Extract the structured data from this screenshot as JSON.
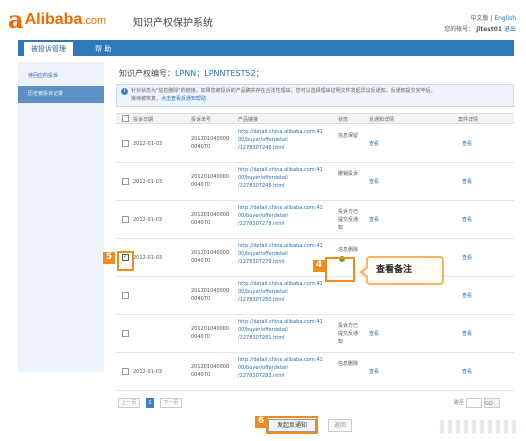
{
  "header": {
    "logo_mark": "a",
    "logo_text": "Alibaba",
    "logo_domain": ".com",
    "system_title": "知识产权保护系统",
    "lang_current": "中文版",
    "lang_separator": "|",
    "lang_english": "English",
    "account_prefix": "您的帐号：",
    "account_name": "jltest01",
    "logout": "退出"
  },
  "nav": {
    "tabs": [
      {
        "label": "被投诉管理"
      },
      {
        "label": "帮 助"
      }
    ]
  },
  "sidebar": {
    "items": [
      {
        "label": "待回应的投诉"
      },
      {
        "label": "历史被投诉记录"
      }
    ]
  },
  "main": {
    "ip_title_prefix": "知识产权编号：",
    "ip_numbers": "LPNN；LPNNTEST52；",
    "notice_icon": "i",
    "notice_text": "针对状态为\"信息删除\"的链接，如果您被投诉的产品确实存在合法性理由，您可以选择理由证明文件发起异议反通知。反通知提交完毕后，",
    "notice_text2": "接待被恢复。",
    "notice_link": "点击查看反通知帮助",
    "columns": [
      "投诉日期",
      "投诉单号",
      "产品链接",
      "状态",
      "反通知详情",
      "案件详情"
    ],
    "rows": [
      {
        "date": "2012-01-03",
        "id1": "201201040000",
        "id2": "004070",
        "url1": "http://detail.china.alibaba.com:41",
        "url2": "00/buyer/offerdetail",
        "url3": "/1278307246.html",
        "status1": "信息保留",
        "status2": "",
        "status3": "",
        "notice": "查看",
        "detail": "查看",
        "checked": false
      },
      {
        "date": "2012-01-03",
        "id1": "201201040000",
        "id2": "004070",
        "url1": "http://detail.china.alibaba.com:41",
        "url2": "00/buyer/offerdetail",
        "url3": "/1278307246.html",
        "status1": "撤销投诉",
        "status2": "",
        "status3": "",
        "notice": "查看",
        "detail": "查看",
        "checked": false
      },
      {
        "date": "2012-01-03",
        "id1": "201201040000",
        "id2": "004070",
        "url1": "http://detail.china.alibaba.com:41",
        "url2": "00/buyer/offerdetail",
        "url3": "/1278307278.html",
        "status1": "投诉方已",
        "status2": "提交反通",
        "status3": "知",
        "notice": "查看",
        "detail": "查看",
        "checked": false
      },
      {
        "date": "2012-01-03",
        "id1": "201201040000",
        "id2": "004070",
        "url1": "http://detail.china.alibaba.com:41",
        "url2": "00/buyer/offerdetail",
        "url3": "/1278307279.html",
        "status1": "信息删除",
        "status2": "",
        "status3": "",
        "notice": "",
        "detail": "查看",
        "checked": true
      },
      {
        "date": "",
        "id1": "201201040000",
        "id2": "004070",
        "url1": "http://detail.china.alibaba.com:41",
        "url2": "00/buyer/offerdetail",
        "url3": "/1278307280.html",
        "status1": "",
        "status2": "",
        "status3": "",
        "notice": "",
        "detail": "查看",
        "checked": false
      },
      {
        "date": "",
        "id1": "201201040000",
        "id2": "004070",
        "url1": "http://detail.china.alibaba.com:41",
        "url2": "00/buyer/offerdetail",
        "url3": "/1278307281.html",
        "status1": "投诉方已",
        "status2": "提交反通",
        "status3": "知",
        "notice": "查看",
        "detail": "查看",
        "checked": false
      },
      {
        "date": "2012-01-03",
        "id1": "201201040000",
        "id2": "004070",
        "url1": "http://detail.china.alibaba.com:41",
        "url2": "00/buyer/offerdetail",
        "url3": "/1278307283.html",
        "status1": "信息删除",
        "status2": "",
        "status3": "",
        "notice": "查看",
        "detail": "查看",
        "checked": false
      }
    ]
  },
  "pager": {
    "prev": "上一页",
    "current": "1",
    "next": "下一页",
    "jump_label": "跳至",
    "go": "GO"
  },
  "actions": {
    "primary": "发起反通知",
    "secondary": "返回"
  },
  "callout": {
    "label": "查看备注"
  },
  "steps": [
    {
      "num": "4"
    },
    {
      "num": "5"
    },
    {
      "num": "6"
    }
  ],
  "colors": {
    "brand": "#f06a00",
    "nav": "#2f78b9",
    "link": "#2a6fb3",
    "annotation": "#f28a1e"
  }
}
